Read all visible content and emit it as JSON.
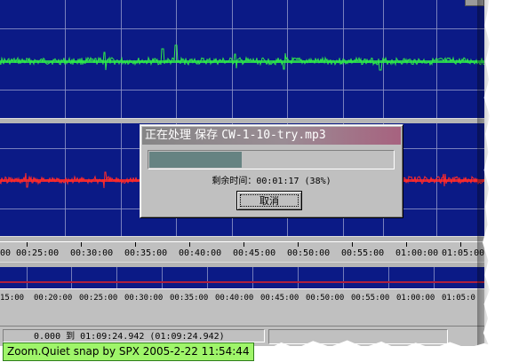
{
  "waveform": {
    "top_channel_color": "#2ee84a",
    "bottom_channel_color": "#ff2a2a",
    "background_color": "#0b1a86"
  },
  "dialog": {
    "title_prefix": "正在处理 保存 ",
    "title_file": "CW-1-10-try.mp3",
    "progress_percent": 38,
    "remaining_label": "剩余时间：",
    "remaining_value": "00:01:17 (38%)",
    "cancel_label": "取消"
  },
  "timeline_main": {
    "labels": [
      "00",
      "00:25:00",
      "00:30:00",
      "00:35:00",
      "00:40:00",
      "00:45:00",
      "00:50:00",
      "00:55:00",
      "01:00:00",
      "01:05:00"
    ]
  },
  "timeline_overview": {
    "labels": [
      "15:00",
      "00:20:00",
      "00:25:00",
      "00:30:00",
      "00:35:00",
      "00:40:00",
      "00:45:00",
      "00:50:00",
      "00:55:00",
      "01:00:00",
      "01:05:0"
    ]
  },
  "status": {
    "selection": "0.000 到 01:09:24.942 (01:09:24.942)"
  },
  "watermark": {
    "text": "Zoom.Quiet snap by SPX 2005-2-22  11:54:44"
  }
}
